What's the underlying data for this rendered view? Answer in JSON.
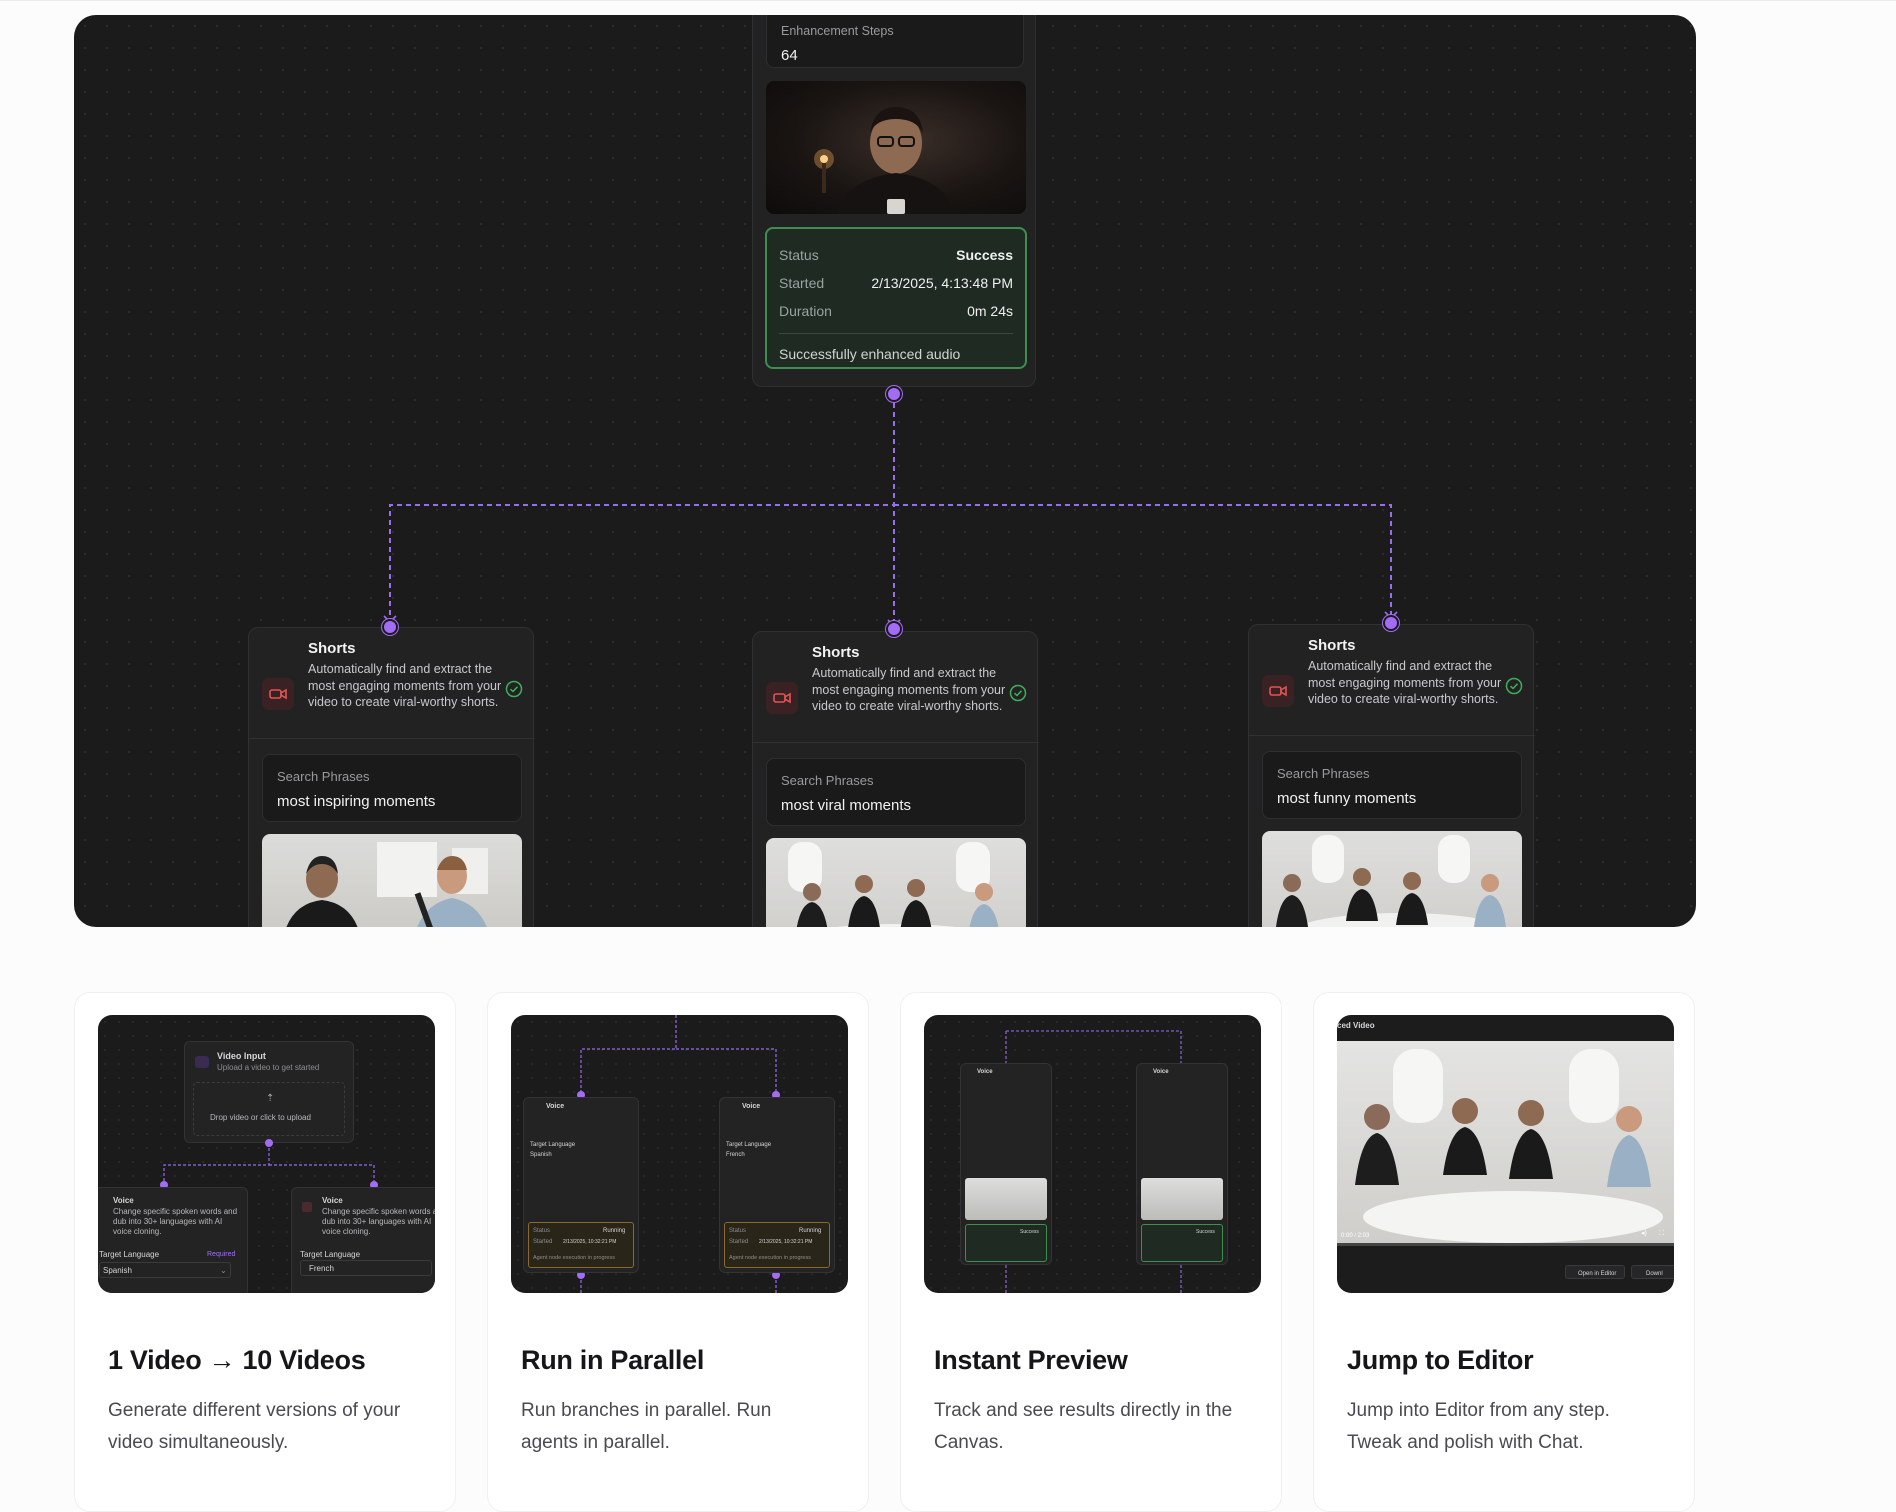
{
  "canvas": {
    "top_node": {
      "field_label": "Enhancement Steps",
      "field_value": "64",
      "status": {
        "status_label": "Status",
        "status_value": "Success",
        "started_label": "Started",
        "started_value": "2/13/2025, 4:13:48 PM",
        "duration_label": "Duration",
        "duration_value": "0m 24s",
        "message": "Successfully enhanced audio"
      }
    },
    "shorts_nodes": [
      {
        "title": "Shorts",
        "description": "Automatically find and extract the most engaging moments from your video to create viral-worthy shorts.",
        "field_label": "Search Phrases",
        "field_value": "most inspiring moments"
      },
      {
        "title": "Shorts",
        "description": "Automatically find and extract the most engaging moments from your video to create viral-worthy shorts.",
        "field_label": "Search Phrases",
        "field_value": "most viral moments"
      },
      {
        "title": "Shorts",
        "description": "Automatically find and extract the most engaging moments from your video to create viral-worthy shorts.",
        "field_label": "Search Phrases",
        "field_value": "most funny moments"
      }
    ],
    "colors": {
      "accent": "#a26cf5",
      "success": "#3e8e52",
      "canvas_bg": "#1b1b1c"
    }
  },
  "features": [
    {
      "title": "1 Video → 10 Videos",
      "description": "Generate different versions of your video simultaneously.",
      "preview": {
        "input_title": "Video Input",
        "input_sub": "Upload a video to get started",
        "drop_text": "Drop video or click to upload",
        "voice_title": "Voice",
        "voice_desc": "Change specific spoken words and dub into 30+ languages with AI voice cloning.",
        "target_label": "Target Language",
        "required": "Required",
        "lang_left": "Spanish",
        "lang_right": "French"
      }
    },
    {
      "title": "Run in Parallel",
      "description": "Run branches in parallel. Run agents in parallel.",
      "preview": {
        "voice_title": "Voice",
        "target_label": "Target Language",
        "lang_left": "Spanish",
        "lang_right": "French",
        "status_label": "Status",
        "status_value": "Running",
        "started_label": "Started",
        "started_value": "2/13/2025, 10:32:21 PM",
        "message": "Agent node execution in progress"
      }
    },
    {
      "title": "Instant Preview",
      "description": "Track and see results directly in the Canvas.",
      "preview": {
        "voice_title": "Voice",
        "status_value": "Success"
      }
    },
    {
      "title": "Jump to Editor",
      "description": "Jump into Editor from any step. Tweak and polish with Chat.",
      "preview": {
        "header": "ced Video",
        "time": "0:00 / 2:03",
        "open_btn": "Open in Editor",
        "download_btn": "Downl"
      }
    }
  ]
}
